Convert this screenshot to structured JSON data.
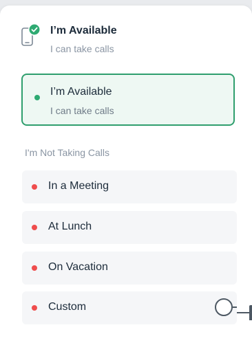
{
  "colors": {
    "available": "#2eaa72",
    "unavailable": "#ef4d4d",
    "card_border": "#2e9e6d",
    "card_background": "#eef8f3",
    "option_background": "#f5f6f8"
  },
  "header": {
    "icon": "phone-check-icon",
    "title": "I’m Available",
    "subtitle": "I can take calls"
  },
  "available_option": {
    "title": "I’m Available",
    "subtitle": "I can take calls",
    "selected": true
  },
  "not_taking_calls": {
    "label": "I'm Not Taking Calls",
    "options": [
      {
        "label": "In a Meeting"
      },
      {
        "label": "At Lunch"
      },
      {
        "label": "On Vacation"
      },
      {
        "label": "Custom"
      }
    ]
  }
}
